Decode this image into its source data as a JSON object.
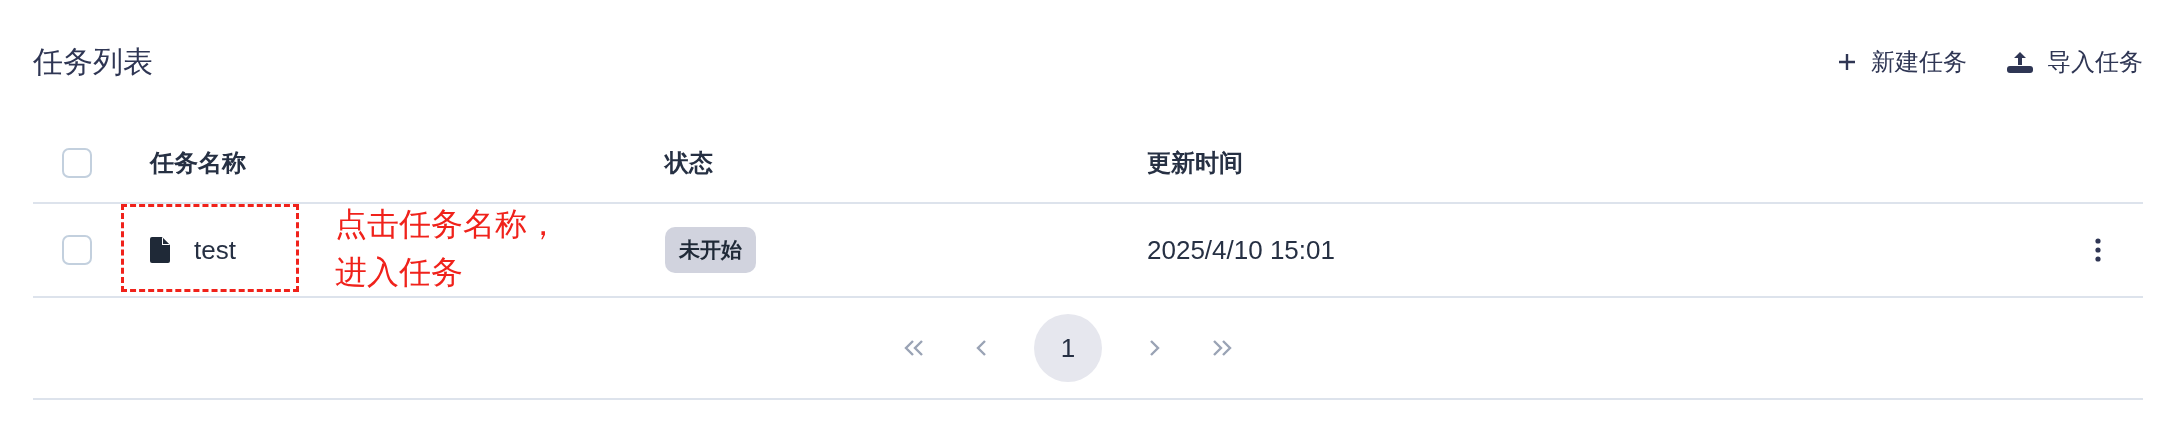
{
  "header": {
    "title": "任务列表",
    "actions": [
      {
        "kind": "add",
        "label": "新建任务"
      },
      {
        "kind": "import",
        "label": "导入任务"
      }
    ]
  },
  "table": {
    "select_all": {
      "checked": false
    },
    "columns": [
      "任务名称",
      "状态",
      "更新时间"
    ],
    "rows": [
      {
        "checked": false,
        "name": "test",
        "status": "未开始",
        "updated": "2025/4/10 15:01"
      }
    ]
  },
  "pagination": {
    "pages": [
      {
        "label": "1",
        "selected": true
      }
    ]
  },
  "annotation": {
    "text_lines": [
      "点击任务名称，",
      "进入任务"
    ]
  }
}
